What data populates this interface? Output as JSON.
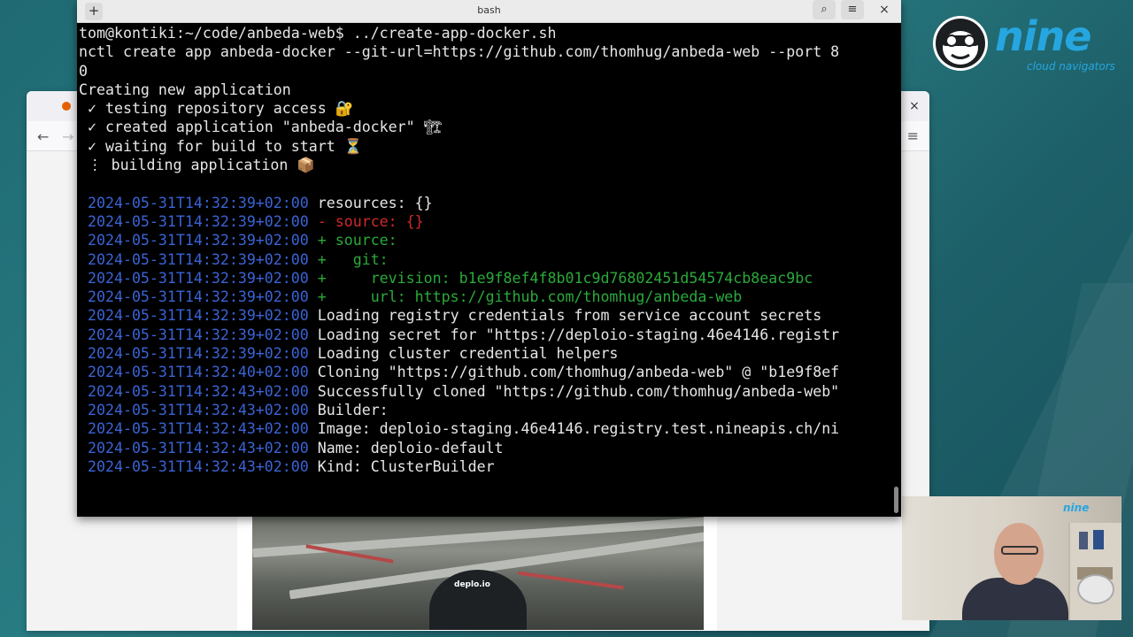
{
  "terminal": {
    "title": "bash",
    "lines": [
      {
        "segments": [
          {
            "t": "tom@kontiki:~/code/anbeda-web$ ../create-app-docker.sh",
            "c": ""
          }
        ]
      },
      {
        "segments": [
          {
            "t": "nctl create app anbeda-docker --git-url=https://github.com/thomhug/anbeda-web --port 8",
            "c": ""
          }
        ]
      },
      {
        "segments": [
          {
            "t": "0",
            "c": ""
          }
        ]
      },
      {
        "segments": [
          {
            "t": "Creating new application",
            "c": ""
          }
        ]
      },
      {
        "segments": [
          {
            "t": " ✓ testing repository access 🔐",
            "c": ""
          }
        ]
      },
      {
        "segments": [
          {
            "t": " ✓ created application \"anbeda-docker\" 🏗",
            "c": ""
          }
        ]
      },
      {
        "segments": [
          {
            "t": " ✓ waiting for build to start ⏳",
            "c": ""
          }
        ]
      },
      {
        "segments": [
          {
            "t": " ⋮ building application 📦",
            "c": ""
          }
        ]
      },
      {
        "segments": [
          {
            "t": "",
            "c": ""
          }
        ]
      },
      {
        "segments": [
          {
            "t": " 2024-05-31T14:32:39+02:00 ",
            "c": "ts"
          },
          {
            "t": "resources: {}",
            "c": ""
          }
        ]
      },
      {
        "segments": [
          {
            "t": " 2024-05-31T14:32:39+02:00 ",
            "c": "ts"
          },
          {
            "t": "- source: {}",
            "c": "red"
          }
        ]
      },
      {
        "segments": [
          {
            "t": " 2024-05-31T14:32:39+02:00 ",
            "c": "ts"
          },
          {
            "t": "+ source:",
            "c": "green"
          }
        ]
      },
      {
        "segments": [
          {
            "t": " 2024-05-31T14:32:39+02:00 ",
            "c": "ts"
          },
          {
            "t": "+   git:",
            "c": "green"
          }
        ]
      },
      {
        "segments": [
          {
            "t": " 2024-05-31T14:32:39+02:00 ",
            "c": "ts"
          },
          {
            "t": "+     revision: b1e9f8ef4f8b01c9d76802451d54574cb8eac9bc",
            "c": "green"
          }
        ]
      },
      {
        "segments": [
          {
            "t": " 2024-05-31T14:32:39+02:00 ",
            "c": "ts"
          },
          {
            "t": "+     url: https://github.com/thomhug/anbeda-web",
            "c": "green"
          }
        ]
      },
      {
        "segments": [
          {
            "t": " 2024-05-31T14:32:39+02:00 ",
            "c": "ts"
          },
          {
            "t": "Loading registry credentials from service account secrets",
            "c": ""
          }
        ]
      },
      {
        "segments": [
          {
            "t": " 2024-05-31T14:32:39+02:00 ",
            "c": "ts"
          },
          {
            "t": "Loading secret for \"https://deploio-staging.46e4146.registr",
            "c": ""
          }
        ]
      },
      {
        "segments": [
          {
            "t": " 2024-05-31T14:32:39+02:00 ",
            "c": "ts"
          },
          {
            "t": "Loading cluster credential helpers",
            "c": ""
          }
        ]
      },
      {
        "segments": [
          {
            "t": " 2024-05-31T14:32:40+02:00 ",
            "c": "ts"
          },
          {
            "t": "Cloning \"https://github.com/thomhug/anbeda-web\" @ \"b1e9f8ef",
            "c": ""
          }
        ]
      },
      {
        "segments": [
          {
            "t": " 2024-05-31T14:32:43+02:00 ",
            "c": "ts"
          },
          {
            "t": "Successfully cloned \"https://github.com/thomhug/anbeda-web\"",
            "c": ""
          }
        ]
      },
      {
        "segments": [
          {
            "t": " 2024-05-31T14:32:43+02:00 ",
            "c": "ts"
          },
          {
            "t": "Builder:",
            "c": ""
          }
        ]
      },
      {
        "segments": [
          {
            "t": " 2024-05-31T14:32:43+02:00 ",
            "c": "ts"
          },
          {
            "t": "Image: deploio-staging.46e4146.registry.test.nineapis.ch/ni",
            "c": ""
          }
        ]
      },
      {
        "segments": [
          {
            "t": " 2024-05-31T14:32:43+02:00 ",
            "c": "ts"
          },
          {
            "t": "Name: deploio-default",
            "c": ""
          }
        ]
      },
      {
        "segments": [
          {
            "t": " 2024-05-31T14:32:43+02:00 ",
            "c": "ts"
          },
          {
            "t": "Kind: ClusterBuilder",
            "c": ""
          }
        ]
      }
    ],
    "buttons": {
      "new_tab": "+",
      "search": "⌕",
      "menu": "≡",
      "close": "×"
    }
  },
  "browser": {
    "close": "×",
    "back": "←",
    "forward": "→",
    "menu": "≡"
  },
  "branding": {
    "word": "nine",
    "tagline": "cloud navigators",
    "webcam_word": "nine",
    "photo_logo": "deplo.io",
    "accent": "#26a6e0"
  },
  "colors": {
    "timestamp": "#3a64d6",
    "removed": "#d12a2a",
    "added": "#2aaa3a"
  }
}
